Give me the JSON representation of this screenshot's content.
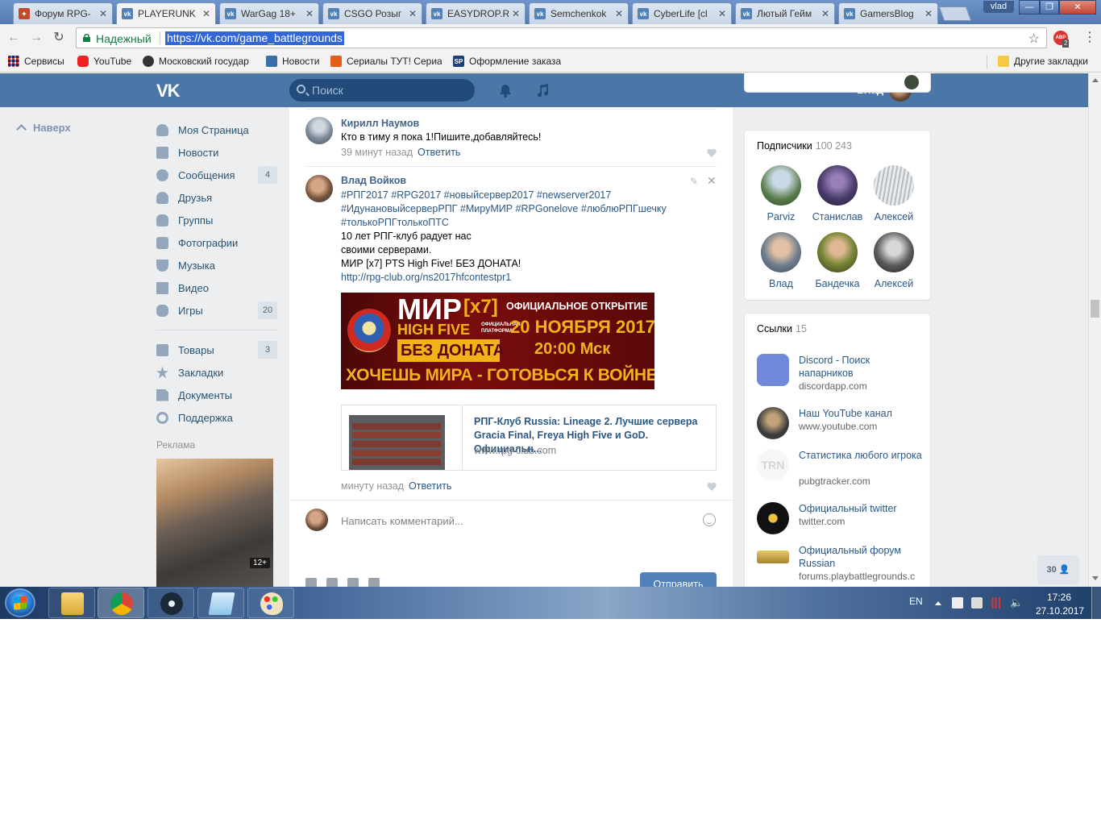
{
  "browser": {
    "tabs": [
      {
        "title": "Форум RPG-",
        "icon": "forum-favicon"
      },
      {
        "title": "PLAYERUNK",
        "icon": "vk-favicon",
        "active": true
      },
      {
        "title": "WarGag 18+",
        "icon": "vk-favicon"
      },
      {
        "title": "CSGO Розыг",
        "icon": "vk-favicon"
      },
      {
        "title": "EASYDROP.R",
        "icon": "vk-favicon"
      },
      {
        "title": "Semchenkok",
        "icon": "vk-favicon"
      },
      {
        "title": "CyberLife [cl",
        "icon": "vk-favicon"
      },
      {
        "title": "Лютый Гейм",
        "icon": "vk-favicon"
      },
      {
        "title": "GamersBlog",
        "icon": "vk-favicon"
      }
    ],
    "window_user": "vlad",
    "security_label": "Надежный",
    "url": "https://vk.com/game_battlegrounds",
    "bookmarks": [
      {
        "label": "Сервисы"
      },
      {
        "label": "YouTube"
      },
      {
        "label": "Московский государ"
      },
      {
        "label": "Новости"
      },
      {
        "label": "Сериалы ТУТ! Сериа"
      },
      {
        "label": "Оформление заказа",
        "icon_text": "SP"
      }
    ],
    "other_bookmarks": "Другие закладки",
    "adblock_label": "ABP",
    "adblock_count": "2"
  },
  "vk": {
    "logo": "VK",
    "search_placeholder": "Поиск",
    "user_name": "Влад",
    "back_to_top": "Наверх",
    "nav": [
      {
        "label": "Моя Страница",
        "icon": "user-icon"
      },
      {
        "label": "Новости",
        "icon": "news-icon"
      },
      {
        "label": "Сообщения",
        "icon": "messages-icon",
        "count": "4"
      },
      {
        "label": "Друзья",
        "icon": "friends-icon"
      },
      {
        "label": "Группы",
        "icon": "groups-icon"
      },
      {
        "label": "Фотографии",
        "icon": "camera-icon"
      },
      {
        "label": "Музыка",
        "icon": "music-icon"
      },
      {
        "label": "Видео",
        "icon": "video-icon"
      },
      {
        "label": "Игры",
        "icon": "games-icon",
        "count": "20"
      }
    ],
    "nav2": [
      {
        "label": "Товары",
        "icon": "bag-icon",
        "count": "3"
      },
      {
        "label": "Закладки",
        "icon": "star-icon"
      },
      {
        "label": "Документы",
        "icon": "document-icon"
      },
      {
        "label": "Поддержка",
        "icon": "support-icon"
      }
    ],
    "ad_label": "Реклама",
    "ad_badge": "12+",
    "comments": [
      {
        "author": "Кирилл Наумов",
        "text": "Кто в тиму я пока 1!Пишите,добавляйтесь!",
        "time": "39 минут назад",
        "reply": "Ответить"
      },
      {
        "author": "Влад Войков",
        "hashtags": [
          "#РПГ2017 #RPG2017 #новыйсервер2017 #newserver2017",
          "#ИдунановыйсерверРПГ #МируМИР #RPGonelove #люблюРПГшечку",
          "#толькоРПГтолькоПТС"
        ],
        "lines": [
          "10 лет РПГ-клуб радует нас",
          "своими серверами.",
          "МИР [x7] PTS High Five! БЕЗ ДОНАТА!"
        ],
        "link": "http://rpg-club.org/ns2017hfcontestpr1",
        "time": "минуту назад",
        "reply": "Ответить"
      }
    ],
    "banner": {
      "mir": "МИР",
      "x7": "[x7]",
      "hf": "HIGH FIVE",
      "platform1": "ОФИЦИАЛЬНАЯ",
      "platform2": "ПЛАТФОРМА",
      "bez": "БЕЗ ДОНАТА",
      "opening": "ОФИЦИАЛЬНОЕ ОТКРЫТИЕ",
      "date": "20 НОЯБРЯ 2017",
      "time": "20:00 Мск",
      "slogan": "ХОЧЕШЬ МИРА - ГОТОВЬСЯ К ВОЙНЕ"
    },
    "attachment": {
      "title": "РПГ-Клуб Russia: Lineage 2. Лучшие сервера Gracia Final, Freya High Five и GoD. Официальн...",
      "url": "www.rpg-club.com"
    },
    "write_placeholder": "Написать комментарий...",
    "send_label": "Отправить",
    "followers": {
      "title": "Подписчики",
      "count": "100 243",
      "people": [
        {
          "name": "Parviz",
          "color": "#5a7d4a"
        },
        {
          "name": "Станислав",
          "color": "#4a3d6b"
        },
        {
          "name": "Алексей",
          "color": "#cfd3d6"
        },
        {
          "name": "Влад",
          "color": "#6f7f8f"
        },
        {
          "name": "Бандечка",
          "color": "#7d8a3a"
        },
        {
          "name": "Алексей",
          "color": "#5b5b5b"
        }
      ]
    },
    "links": {
      "title": "Ссылки",
      "count": "15",
      "items": [
        {
          "title": "Discord - Поиск напарников",
          "url": "discordapp.com",
          "color": "#7289da"
        },
        {
          "title": "Наш YouTube канал",
          "url": "www.youtube.com",
          "color": "#3a3a3a"
        },
        {
          "title": "Статистика любого игрока",
          "url": "pubgtracker.com",
          "color": "#f4f4f4",
          "logo": "TRN"
        },
        {
          "title": "Официальный twitter",
          "url": "twitter.com",
          "color": "#111111"
        },
        {
          "title": "Официальный форум Russian",
          "url": "forums.playbattlegrounds.c",
          "color": "#c9a24a"
        }
      ]
    },
    "friends_online": "30"
  },
  "taskbar": {
    "lang": "EN",
    "time": "17:26",
    "date": "27.10.2017"
  }
}
